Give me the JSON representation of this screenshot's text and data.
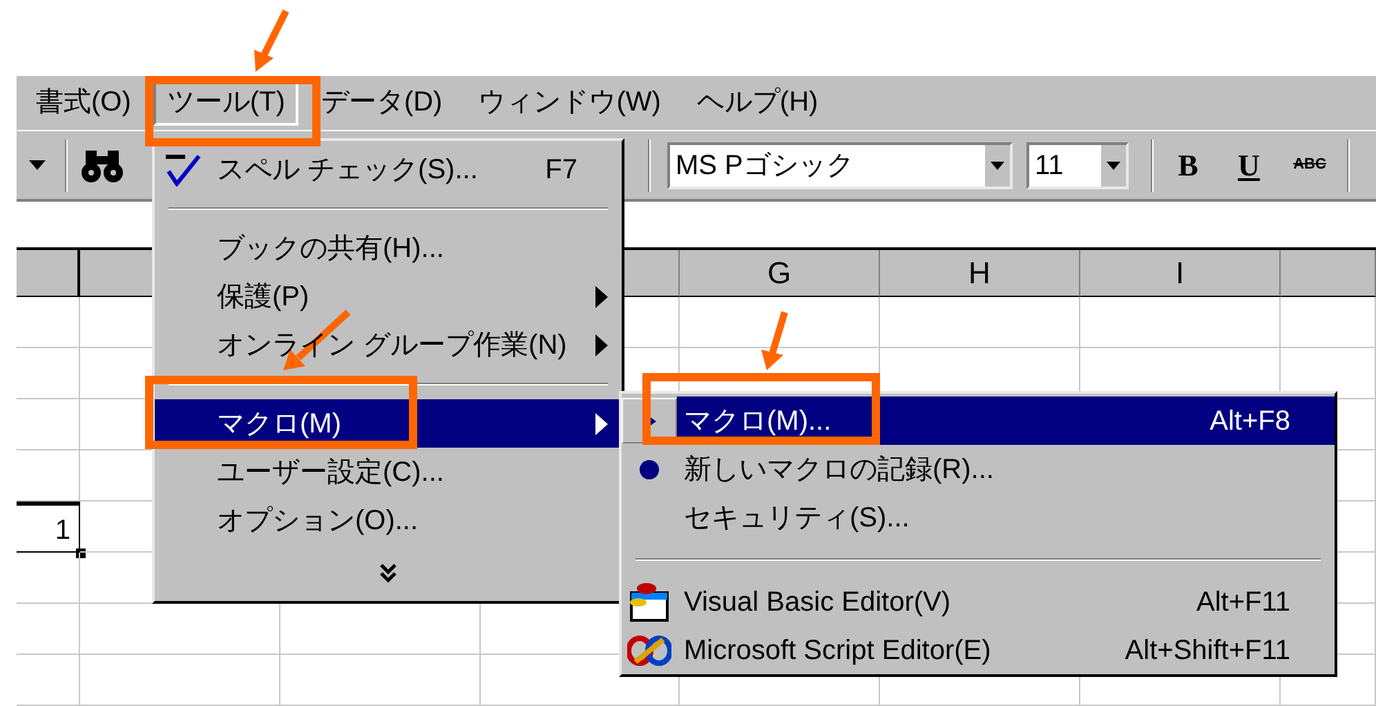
{
  "menu_bar": {
    "items": [
      {
        "label": "書式(O)",
        "selected": false
      },
      {
        "label": "ツール(T)",
        "selected": true
      },
      {
        "label": "データ(D)",
        "selected": false
      },
      {
        "label": "ウィンドウ(W)",
        "selected": false
      },
      {
        "label": "ヘルプ(H)",
        "selected": false
      }
    ]
  },
  "toolbar": {
    "font_name": "MS Pゴシック",
    "font_size": "11",
    "bold_button": "B",
    "underline_button": "U",
    "strikethrough_button": "ABC"
  },
  "sheet": {
    "column_headers": [
      "G",
      "H",
      "I"
    ],
    "active_cell": {
      "value": "1"
    }
  },
  "tools_menu": {
    "items": [
      {
        "kind": "item",
        "label": "スペル チェック(S)...",
        "shortcut": "F7",
        "submenu": false,
        "selected": false
      },
      {
        "kind": "separator"
      },
      {
        "kind": "item",
        "label": "ブックの共有(H)...",
        "submenu": false,
        "selected": false
      },
      {
        "kind": "item",
        "label": "保護(P)",
        "submenu": true,
        "selected": false
      },
      {
        "kind": "item",
        "label": "オンライン グループ作業(N)",
        "submenu": true,
        "selected": false
      },
      {
        "kind": "separator"
      },
      {
        "kind": "item",
        "label": "マクロ(M)",
        "submenu": true,
        "selected": true
      },
      {
        "kind": "item",
        "label": "ユーザー設定(C)...",
        "submenu": false,
        "selected": false
      },
      {
        "kind": "item",
        "label": "オプション(O)...",
        "submenu": false,
        "selected": false
      },
      {
        "kind": "more"
      }
    ]
  },
  "macro_submenu": {
    "items": [
      {
        "kind": "item",
        "label": "マクロ(M)...",
        "shortcut": "Alt+F8",
        "submenu": false,
        "selected": true
      },
      {
        "kind": "item",
        "label": "新しいマクロの記録(R)...",
        "submenu": false,
        "selected": false
      },
      {
        "kind": "item",
        "label": "セキュリティ(S)...",
        "submenu": false,
        "selected": false
      },
      {
        "kind": "separator"
      },
      {
        "kind": "item",
        "label": "Visual Basic Editor(V)",
        "shortcut": "Alt+F11",
        "submenu": false,
        "selected": false
      },
      {
        "kind": "item",
        "label": "Microsoft Script Editor(E)",
        "shortcut": "Alt+Shift+F11",
        "submenu": false,
        "selected": false
      }
    ]
  }
}
